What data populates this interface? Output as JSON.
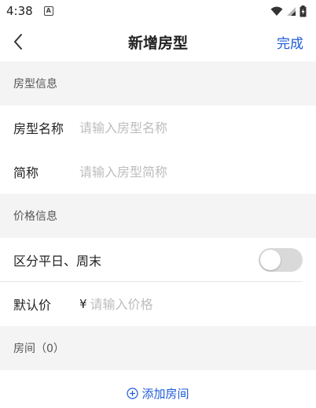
{
  "status_bar": {
    "time": "4:38",
    "notification_badge": "A"
  },
  "nav": {
    "title": "新增房型",
    "done_label": "完成"
  },
  "room_type_section": {
    "header": "房型信息",
    "name_label": "房型名称",
    "name_placeholder": "请输入房型名称",
    "short_label": "简称",
    "short_placeholder": "请输入房型简称"
  },
  "price_section": {
    "header": "价格信息",
    "weekday_weekend_label": "区分平日、周末",
    "weekday_weekend_enabled": false,
    "default_price_label": "默认价",
    "currency_symbol": "¥",
    "price_placeholder": "请输入价格"
  },
  "rooms_section": {
    "header": "房间（0）",
    "add_label": "添加房间"
  },
  "colors": {
    "accent": "#1e5bd6",
    "section_bg": "#f4f4f4",
    "switch_off": "#d9d9d9"
  }
}
